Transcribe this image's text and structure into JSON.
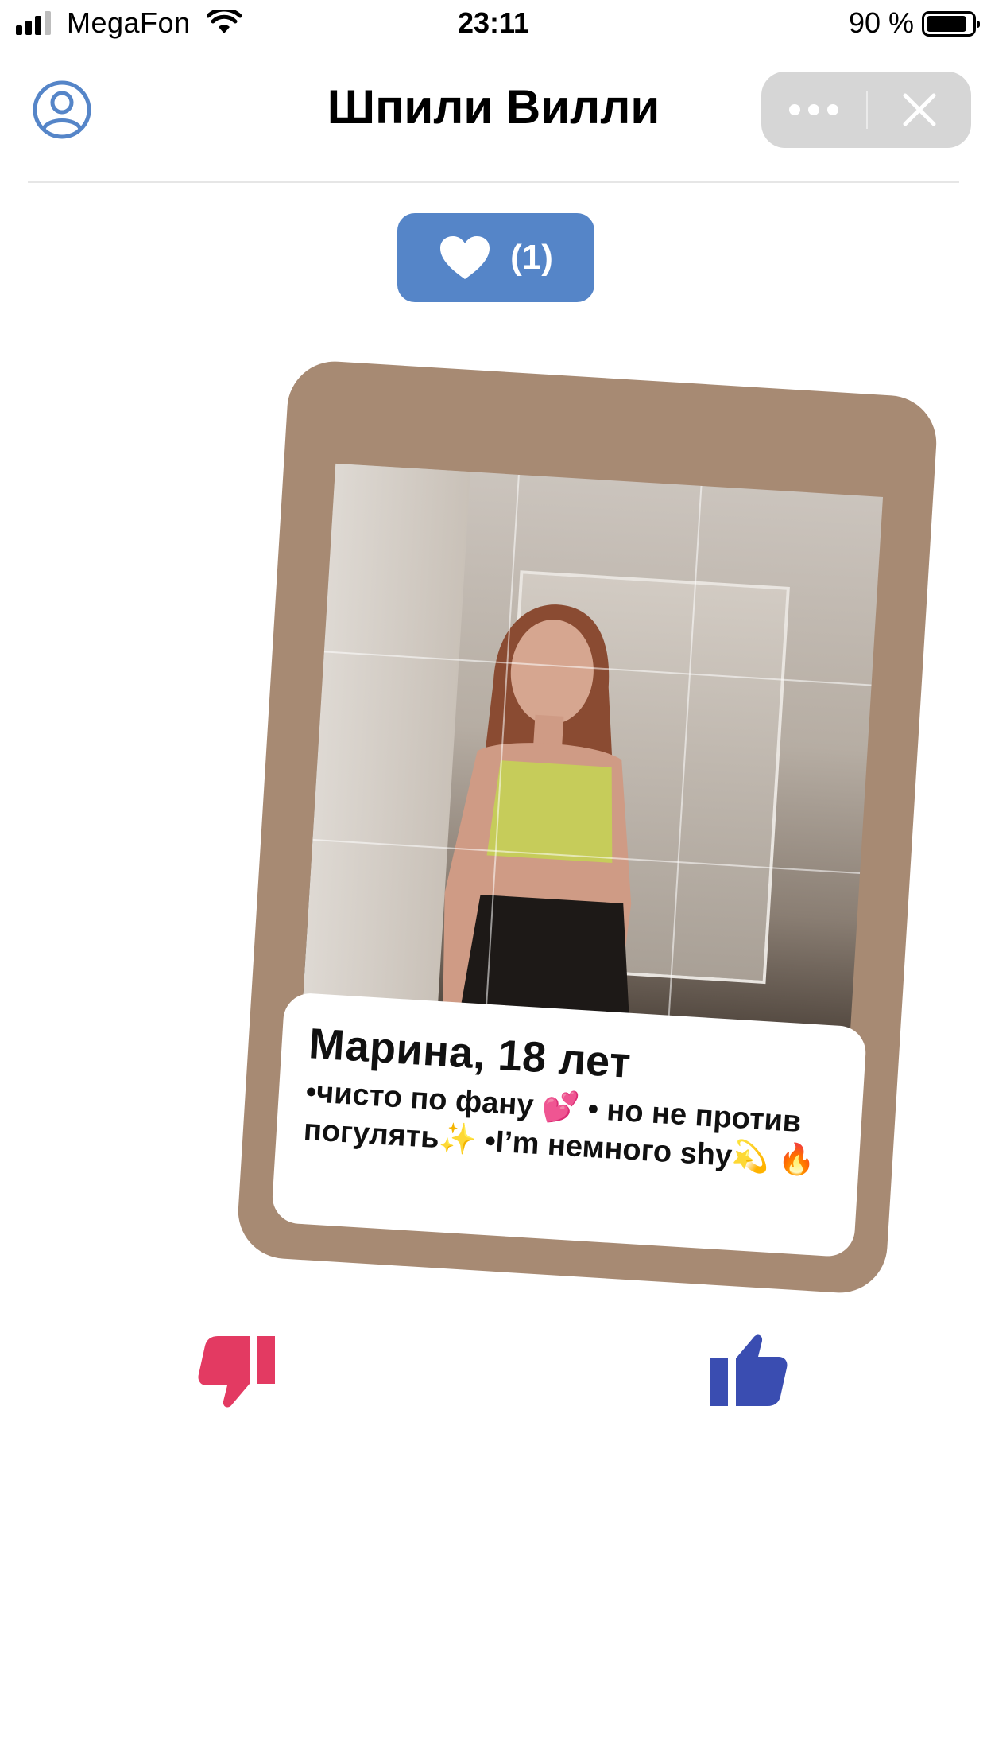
{
  "status_bar": {
    "carrier": "MegaFon",
    "time": "23:11",
    "battery_percent": "90 %",
    "battery_level": 0.9
  },
  "header": {
    "title": "Шпили Вилли",
    "profile_icon": "user-circle-icon",
    "more_icon": "more-dots-icon",
    "close_icon": "close-icon"
  },
  "likes": {
    "icon": "heart-icon",
    "count": "(1)"
  },
  "profile_card": {
    "name": "Марина, 18 лет",
    "bio": "•чисто по фану 💕 • но не против погулять✨ •I’m немного shy💫 🔥"
  },
  "actions": {
    "dislike_icon": "thumbs-down-icon",
    "like_icon": "thumbs-up-icon"
  },
  "colors": {
    "accent_blue": "#5585c8",
    "card_background": "#a78a73",
    "dislike": "#e33a62",
    "like": "#3a4db1"
  }
}
